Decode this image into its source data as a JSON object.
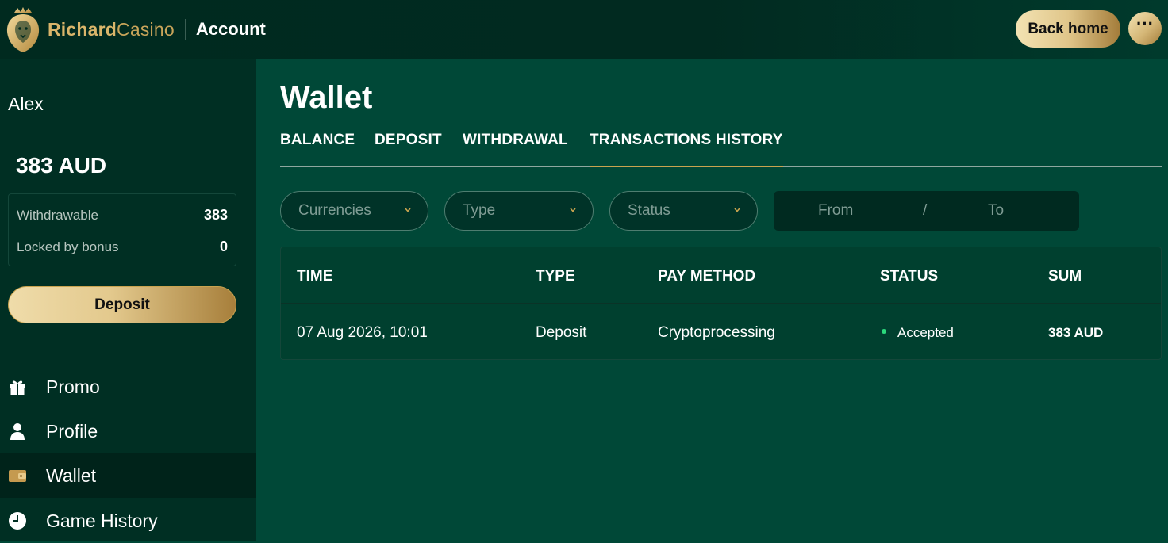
{
  "header": {
    "brand_part1": "Richard",
    "brand_part2": "Casino",
    "section_title": "Account",
    "back_home_label": "Back home",
    "more_label": "···"
  },
  "sidebar": {
    "username": "Alex",
    "balance": "383 AUD",
    "withdrawable_label": "Withdrawable",
    "withdrawable_value": "383",
    "locked_label": "Locked by bonus",
    "locked_value": "0",
    "deposit_label": "Deposit",
    "nav": [
      {
        "label": "Promo",
        "icon": "gift-icon",
        "active": false
      },
      {
        "label": "Profile",
        "icon": "user-icon",
        "active": false
      },
      {
        "label": "Wallet",
        "icon": "wallet-icon",
        "active": true
      },
      {
        "label": "Game History",
        "icon": "clock-icon",
        "active": false
      }
    ]
  },
  "main": {
    "title": "Wallet",
    "tabs": [
      {
        "label": "BALANCE",
        "active": false
      },
      {
        "label": "DEPOSIT",
        "active": false
      },
      {
        "label": "WITHDRAWAL",
        "active": false
      },
      {
        "label": "TRANSACTIONS HISTORY",
        "active": true
      }
    ],
    "filters": {
      "currencies_placeholder": "Currencies",
      "type_placeholder": "Type",
      "status_placeholder": "Status",
      "from_placeholder": "From",
      "separator": "/",
      "to_placeholder": "To"
    },
    "table": {
      "columns": [
        "TIME",
        "TYPE",
        "PAY METHOD",
        "STATUS",
        "SUM"
      ],
      "rows": [
        {
          "time": "07 Aug 2026, 10:01",
          "type": "Deposit",
          "method": "Cryptoprocessing",
          "status": "Accepted",
          "sum": "383 AUD"
        }
      ]
    }
  },
  "colors": {
    "accent_gold": "#c9a34f",
    "background": "#004837",
    "sidebar": "#002f23",
    "status_accepted": "#2bd97c"
  }
}
